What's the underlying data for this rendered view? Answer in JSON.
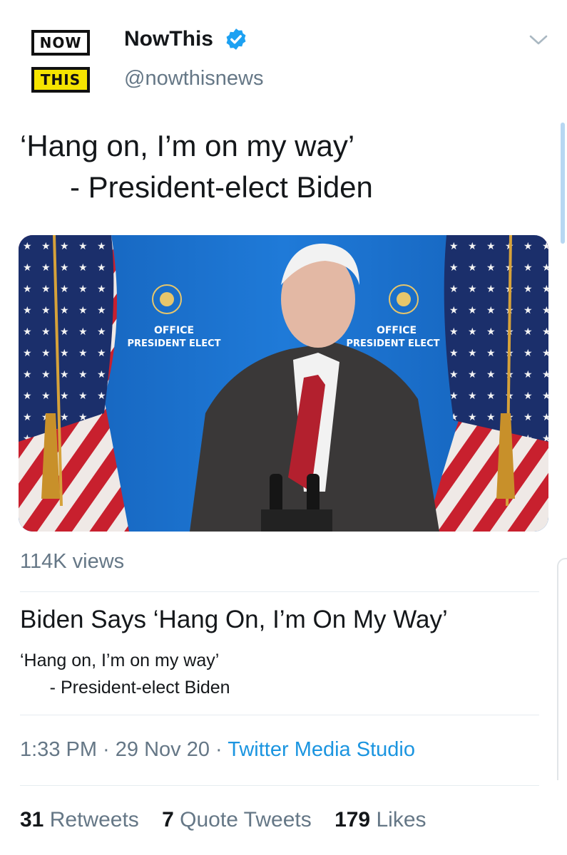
{
  "author": {
    "logo_top": "NOW",
    "logo_bottom": "THIS",
    "name": "NowThis",
    "handle": "@nowthisnews",
    "verified_icon": "verified-badge-icon",
    "menu_icon": "chevron-down-icon"
  },
  "tweet": {
    "text": "‘Hang on, I’m on my way’\n      - President-elect Biden"
  },
  "media": {
    "backdrop_text_line1": "OFFICE",
    "backdrop_text_line2": "PRESIDENT ELECT",
    "views": "114K views"
  },
  "card": {
    "title": "Biden Says ‘Hang On, I’m On My Way’",
    "description": "‘Hang on, I’m on my way’\n      - President-elect Biden"
  },
  "meta": {
    "time": "1:33 PM",
    "date": "29 Nov 20",
    "separator": " · ",
    "source": "Twitter Media Studio"
  },
  "stats": {
    "retweets_count": "31",
    "retweets_label": "Retweets",
    "quotes_count": "7",
    "quotes_label": "Quote Tweets",
    "likes_count": "179",
    "likes_label": "Likes"
  },
  "colors": {
    "link": "#1b95e0",
    "secondary_text": "#657786",
    "backdrop_blue": "#1b6fce",
    "logo_yellow": "#f5e400"
  }
}
